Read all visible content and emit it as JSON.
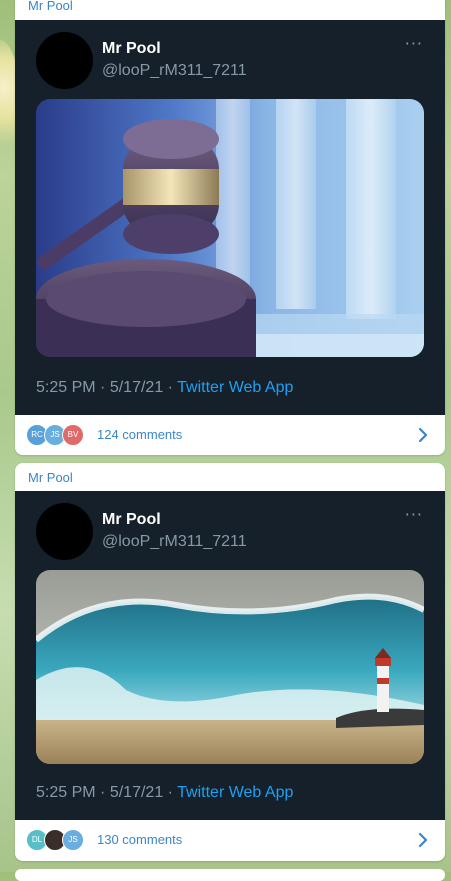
{
  "posts": [
    {
      "channel": "Mr Pool",
      "tweet": {
        "display_name": "Mr Pool",
        "handle": "@looP_rM311_7211",
        "more": "···",
        "time": "5:25 PM",
        "date": "5/17/21",
        "source": "Twitter Web App",
        "image_subject": "gavel"
      },
      "commenters": [
        {
          "initials": "RC",
          "color": "#5aa0d8"
        },
        {
          "initials": "JS",
          "color": "#6aaee0"
        },
        {
          "initials": "BV",
          "color": "#e06a6a"
        }
      ],
      "comments_label": "124 comments"
    },
    {
      "channel": "Mr Pool",
      "tweet": {
        "display_name": "Mr Pool",
        "handle": "@looP_rM311_7211",
        "more": "···",
        "time": "5:25 PM",
        "date": "5/17/21",
        "source": "Twitter Web App",
        "image_subject": "wave-lighthouse"
      },
      "commenters": [
        {
          "initials": "DL",
          "color": "#56c0c6"
        },
        {
          "initials": "",
          "color": "#3a2e28"
        },
        {
          "initials": "JS",
          "color": "#6aaee0"
        }
      ],
      "comments_label": "130 comments"
    }
  ],
  "colors": {
    "accent": "#3a86c8",
    "twitter_blue": "#1da1f2",
    "tweet_bg": "#15202b",
    "muted": "#8899a6"
  }
}
